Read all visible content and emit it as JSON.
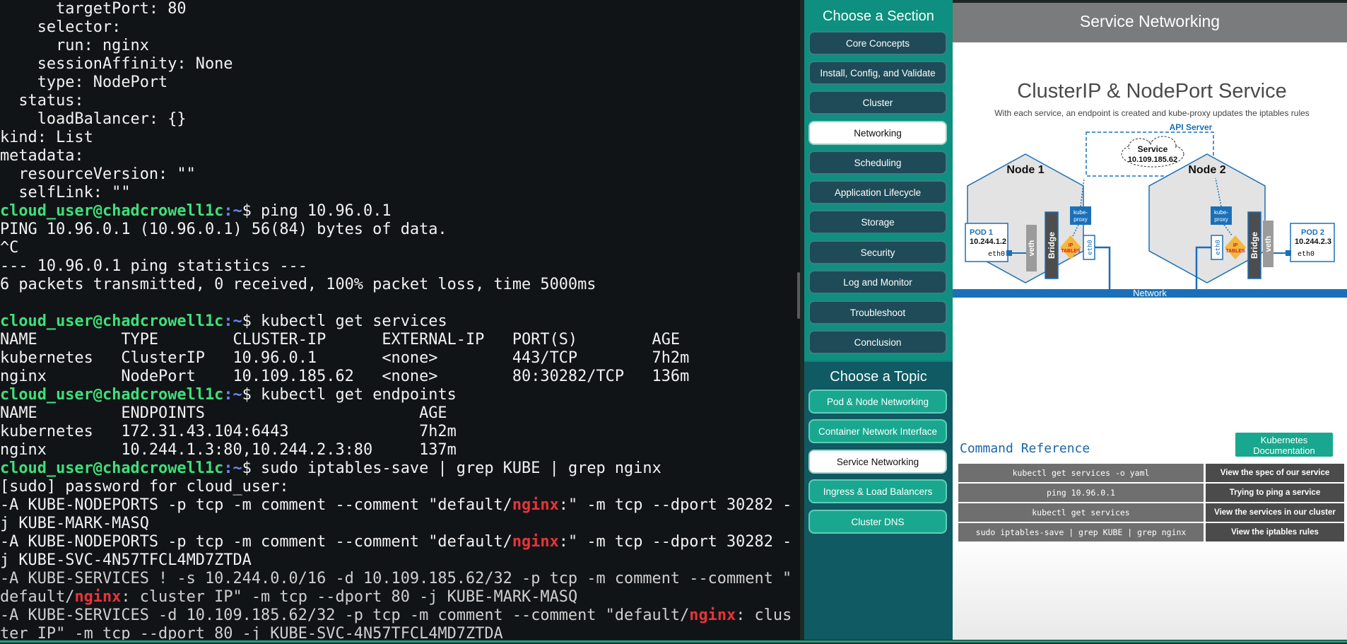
{
  "terminal": {
    "lines": [
      "      targetPort: 80",
      "    selector:",
      "      run: nginx",
      "    sessionAffinity: None",
      "    type: NodePort",
      "  status:",
      "    loadBalancer: {}",
      "kind: List",
      "metadata:",
      "  resourceVersion: \"\"",
      "  selfLink: \"\""
    ],
    "prompt_user": "cloud_user@chadcrowell1c",
    "prompt_path": ":~",
    "prompt_symbol": "$",
    "cmd_ping": " ping 10.96.0.1",
    "ping_out_1": "PING 10.96.0.1 (10.96.0.1) 56(84) bytes of data.",
    "ping_out_2": "^C",
    "ping_out_3": "--- 10.96.0.1 ping statistics ---",
    "ping_out_4": "6 packets transmitted, 0 received, 100% packet loss, time 5000ms",
    "cmd_services": " kubectl get services",
    "services_header": "NAME         TYPE        CLUSTER-IP      EXTERNAL-IP   PORT(S)        AGE",
    "services_rows": [
      "kubernetes   ClusterIP   10.96.0.1       <none>        443/TCP        7h2m",
      "nginx        NodePort    10.109.185.62   <none>        80:30282/TCP   136m"
    ],
    "cmd_endpoints": " kubectl get endpoints",
    "endpoints_header": "NAME         ENDPOINTS                       AGE",
    "endpoints_rows": [
      "kubernetes   172.31.43.104:6443              7h2m",
      "nginx        10.244.1.3:80,10.244.2.3:80     137m"
    ],
    "cmd_iptables": " sudo iptables-save | grep KUBE | grep nginx",
    "sudo_prompt": "[sudo] password for cloud_user:",
    "ipt": {
      "l1a": "-A KUBE-NODEPORTS -p tcp -m comment --comment \"default/",
      "l1h": "nginx",
      "l1b": ":\" -m tcp --dport 30282 -",
      "l2": "j KUBE-MARK-MASQ",
      "l3a": "-A KUBE-NODEPORTS -p tcp -m comment --comment \"default/",
      "l3h": "nginx",
      "l3b": ":\" -m tcp --dport 30282 -",
      "l4": "j KUBE-SVC-4N57TFCL4MD7ZTDA",
      "l5": "-A KUBE-SERVICES ! -s 10.244.0.0/16 -d 10.109.185.62/32 -p tcp -m comment --comment \"",
      "l6a": "default/",
      "l6h": "nginx",
      "l6b": ": cluster IP\" -m tcp --dport 80 -j KUBE-MARK-MASQ",
      "l7a": "-A KUBE-SERVICES -d 10.109.185.62/32 -p tcp -m comment --comment \"default/",
      "l7h": "nginx",
      "l7b": ": clus",
      "l8": "ter IP\" -m tcp --dport 80 -j KUBE-SVC-4N57TFCL4MD7ZTDA"
    }
  },
  "sidebar": {
    "section_heading": "Choose a Section",
    "sections": [
      "Core Concepts",
      "Install, Config, and Validate",
      "Cluster",
      "Networking",
      "Scheduling",
      "Application Lifecycle",
      "Storage",
      "Security",
      "Log and Monitor",
      "Troubleshoot",
      "Conclusion"
    ],
    "active_section": "Networking",
    "topic_heading": "Choose a Topic",
    "topics": [
      "Pod & Node Networking",
      "Container Network Interface",
      "Service Networking",
      "Ingress & Load Balancers",
      "Cluster DNS"
    ],
    "active_topic": "Service Networking"
  },
  "content": {
    "header": "Service Networking",
    "diagram": {
      "title": "ClusterIP & NodePort Service",
      "subtitle": "With each service, an endpoint is created and kube-proxy updates the iptables rules",
      "api_server": "API Server",
      "service_label": "Service",
      "service_ip": "10.109.185.62",
      "node1": "Node 1",
      "node2": "Node 2",
      "pod1_name": "POD 1",
      "pod1_ip": "10.244.1.2",
      "pod2_name": "POD 2",
      "pod2_ip": "10.244.2.3",
      "eth0": "eth0",
      "veth": "veth",
      "bridge": "Bridge",
      "iptables_1": "IP",
      "iptables_2": "TABLES",
      "kube_proxy_1": "kube-",
      "kube_proxy_2": "proxy",
      "network": "Network"
    },
    "command_reference_title": "Command Reference",
    "kubernetes_docs_button": "Kubernetes Documentation",
    "commands": [
      {
        "cmd": "kubectl get services -o yaml",
        "desc": "View the spec of our service"
      },
      {
        "cmd": "ping 10.96.0.1",
        "desc": "Trying to ping a service"
      },
      {
        "cmd": "kubectl get services",
        "desc": "View the services in our cluster"
      },
      {
        "cmd": "sudo iptables-save | grep KUBE | grep nginx",
        "desc": "View the iptables rules"
      }
    ]
  },
  "colors": {
    "prompt_user": "#3ee07a",
    "prompt_path": "#6a86ff",
    "highlight": "#e8333a",
    "sidebar_teal": "#0e8f7f",
    "button_dark": "#1e4b57",
    "accent_blue": "#1b66a8"
  }
}
